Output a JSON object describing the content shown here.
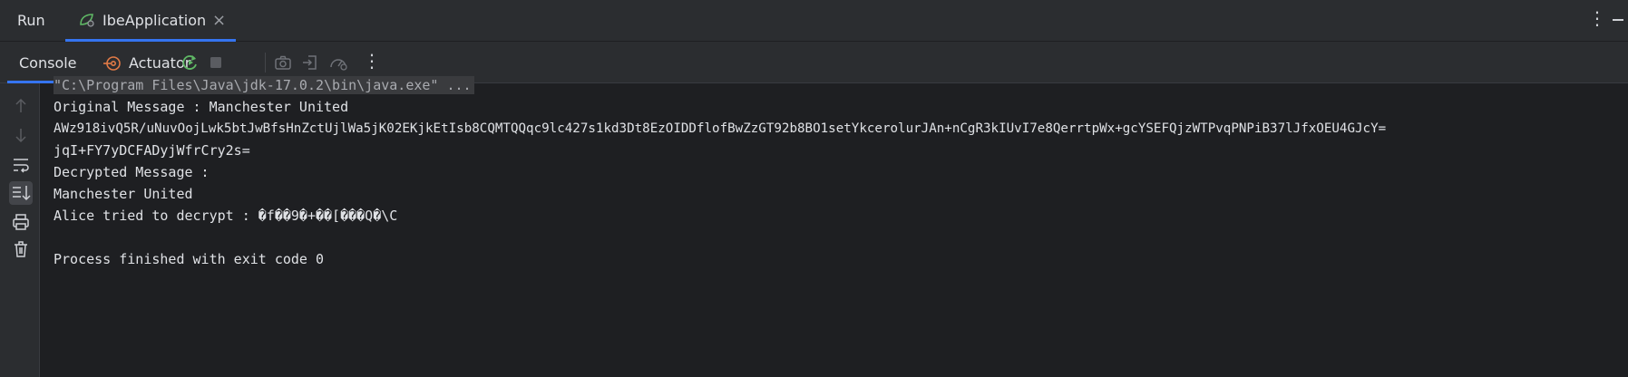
{
  "top": {
    "run_label": "Run",
    "tab_label": "IbeApplication",
    "close_symbol": "×",
    "more_symbol": "⋮"
  },
  "toolbar": {
    "console_tab": "Console",
    "actuator_tab": "Actuator",
    "icons": [
      "rerun-icon",
      "stop-icon",
      "camera-icon",
      "exit-icon",
      "gauge-icon",
      "more-icon"
    ],
    "more_symbol": "⋮"
  },
  "gutter": {
    "icons": [
      "arrow-up-icon",
      "arrow-down-icon",
      "soft-wrap-icon",
      "scroll-to-end-icon",
      "print-icon",
      "trash-icon"
    ]
  },
  "console": {
    "lines": [
      "\"C:\\Program Files\\Java\\jdk-17.0.2\\bin\\java.exe\" ...",
      "Original Message : Manchester United",
      "AWz918ivQ5R/uNuvOojLwk5btJwBfsHnZctUjlWa5jK02EKjkEtIsb8CQMTQQqc9lc427s1kd3Dt8EzOIDDflofBwZzGT92b8BO1setYkcerolurJAn+nCgR3kIUvI7e8QerrtpWx+gcYSEFQjzWTPvqPNPiB37lJfxOEU4GJcY=",
      "jqI+FY7yDCFADyjWfrCry2s=",
      "Decrypted Message :",
      "Manchester United",
      "Alice tried to decrypt : �f��9�+��[���Q�\\C",
      "",
      "Process finished with exit code 0"
    ]
  },
  "colors": {
    "background": "#1e1f22",
    "panel": "#2b2d30",
    "accent": "#3574f0",
    "text": "#dfe1e5",
    "rerun_green": "#5fb865",
    "actuator_orange": "#e07a46"
  }
}
